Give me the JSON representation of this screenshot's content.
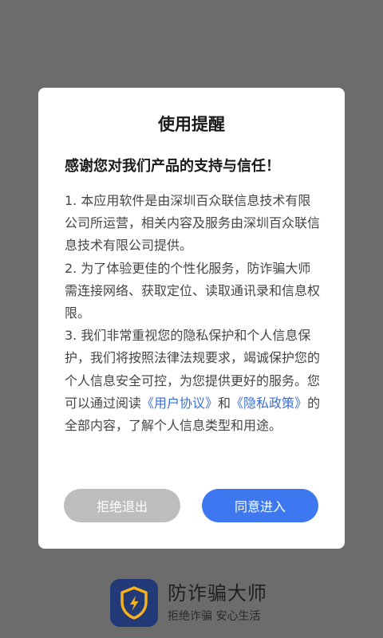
{
  "splash": {
    "app_name": "防诈骗大师",
    "slogan": "拒绝诈骗 安心生活",
    "logo_icon": "shield-lightning-icon",
    "colors": {
      "logo_bg": "#233a78",
      "shield": "#f5b21a"
    }
  },
  "dialog": {
    "title": "使用提醒",
    "subtitle": "感谢您对我们产品的支持与信任！",
    "items": [
      "1. 本应用软件是由深圳百众联信息技术有限公司所运营，相关内容及服务由深圳百众联信息技术有限公司提供。",
      "2. 为了体验更佳的个性化服务，防诈骗大师需连接网络、获取定位、读取通讯录和信息权限。"
    ],
    "item3": {
      "text_before": "3. 我们非常重视您的隐私保护和个人信息保护，我们将按照法律法规要求，竭诚保护您的个人信息安全可控，为您提供更好的服务。您可以通过阅读",
      "user_agreement_link": "《用户协议》",
      "text_and": "和",
      "privacy_policy_link": "《隐私政策》",
      "text_after": "的全部内容，了解个人信息类型和用途。"
    },
    "reject_button": "拒绝退出",
    "agree_button": "同意进入",
    "colors": {
      "link": "#3a6fd8",
      "agree_bg": "#3e78f0",
      "reject_bg": "#bdbdbd"
    }
  }
}
